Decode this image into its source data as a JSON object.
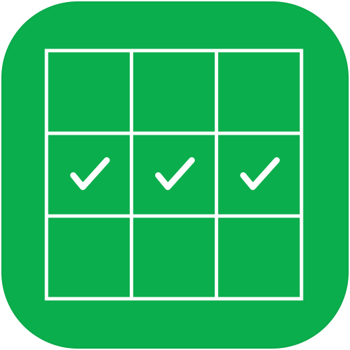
{
  "icon": {
    "background_color": "#0bae4c",
    "line_color": "#ffffff",
    "check_color": "#ffffff",
    "symbol": "check-icon"
  },
  "grid": {
    "rows": 3,
    "columns": 3,
    "cells": [
      [
        false,
        false,
        false
      ],
      [
        true,
        true,
        true
      ],
      [
        false,
        false,
        false
      ]
    ]
  }
}
